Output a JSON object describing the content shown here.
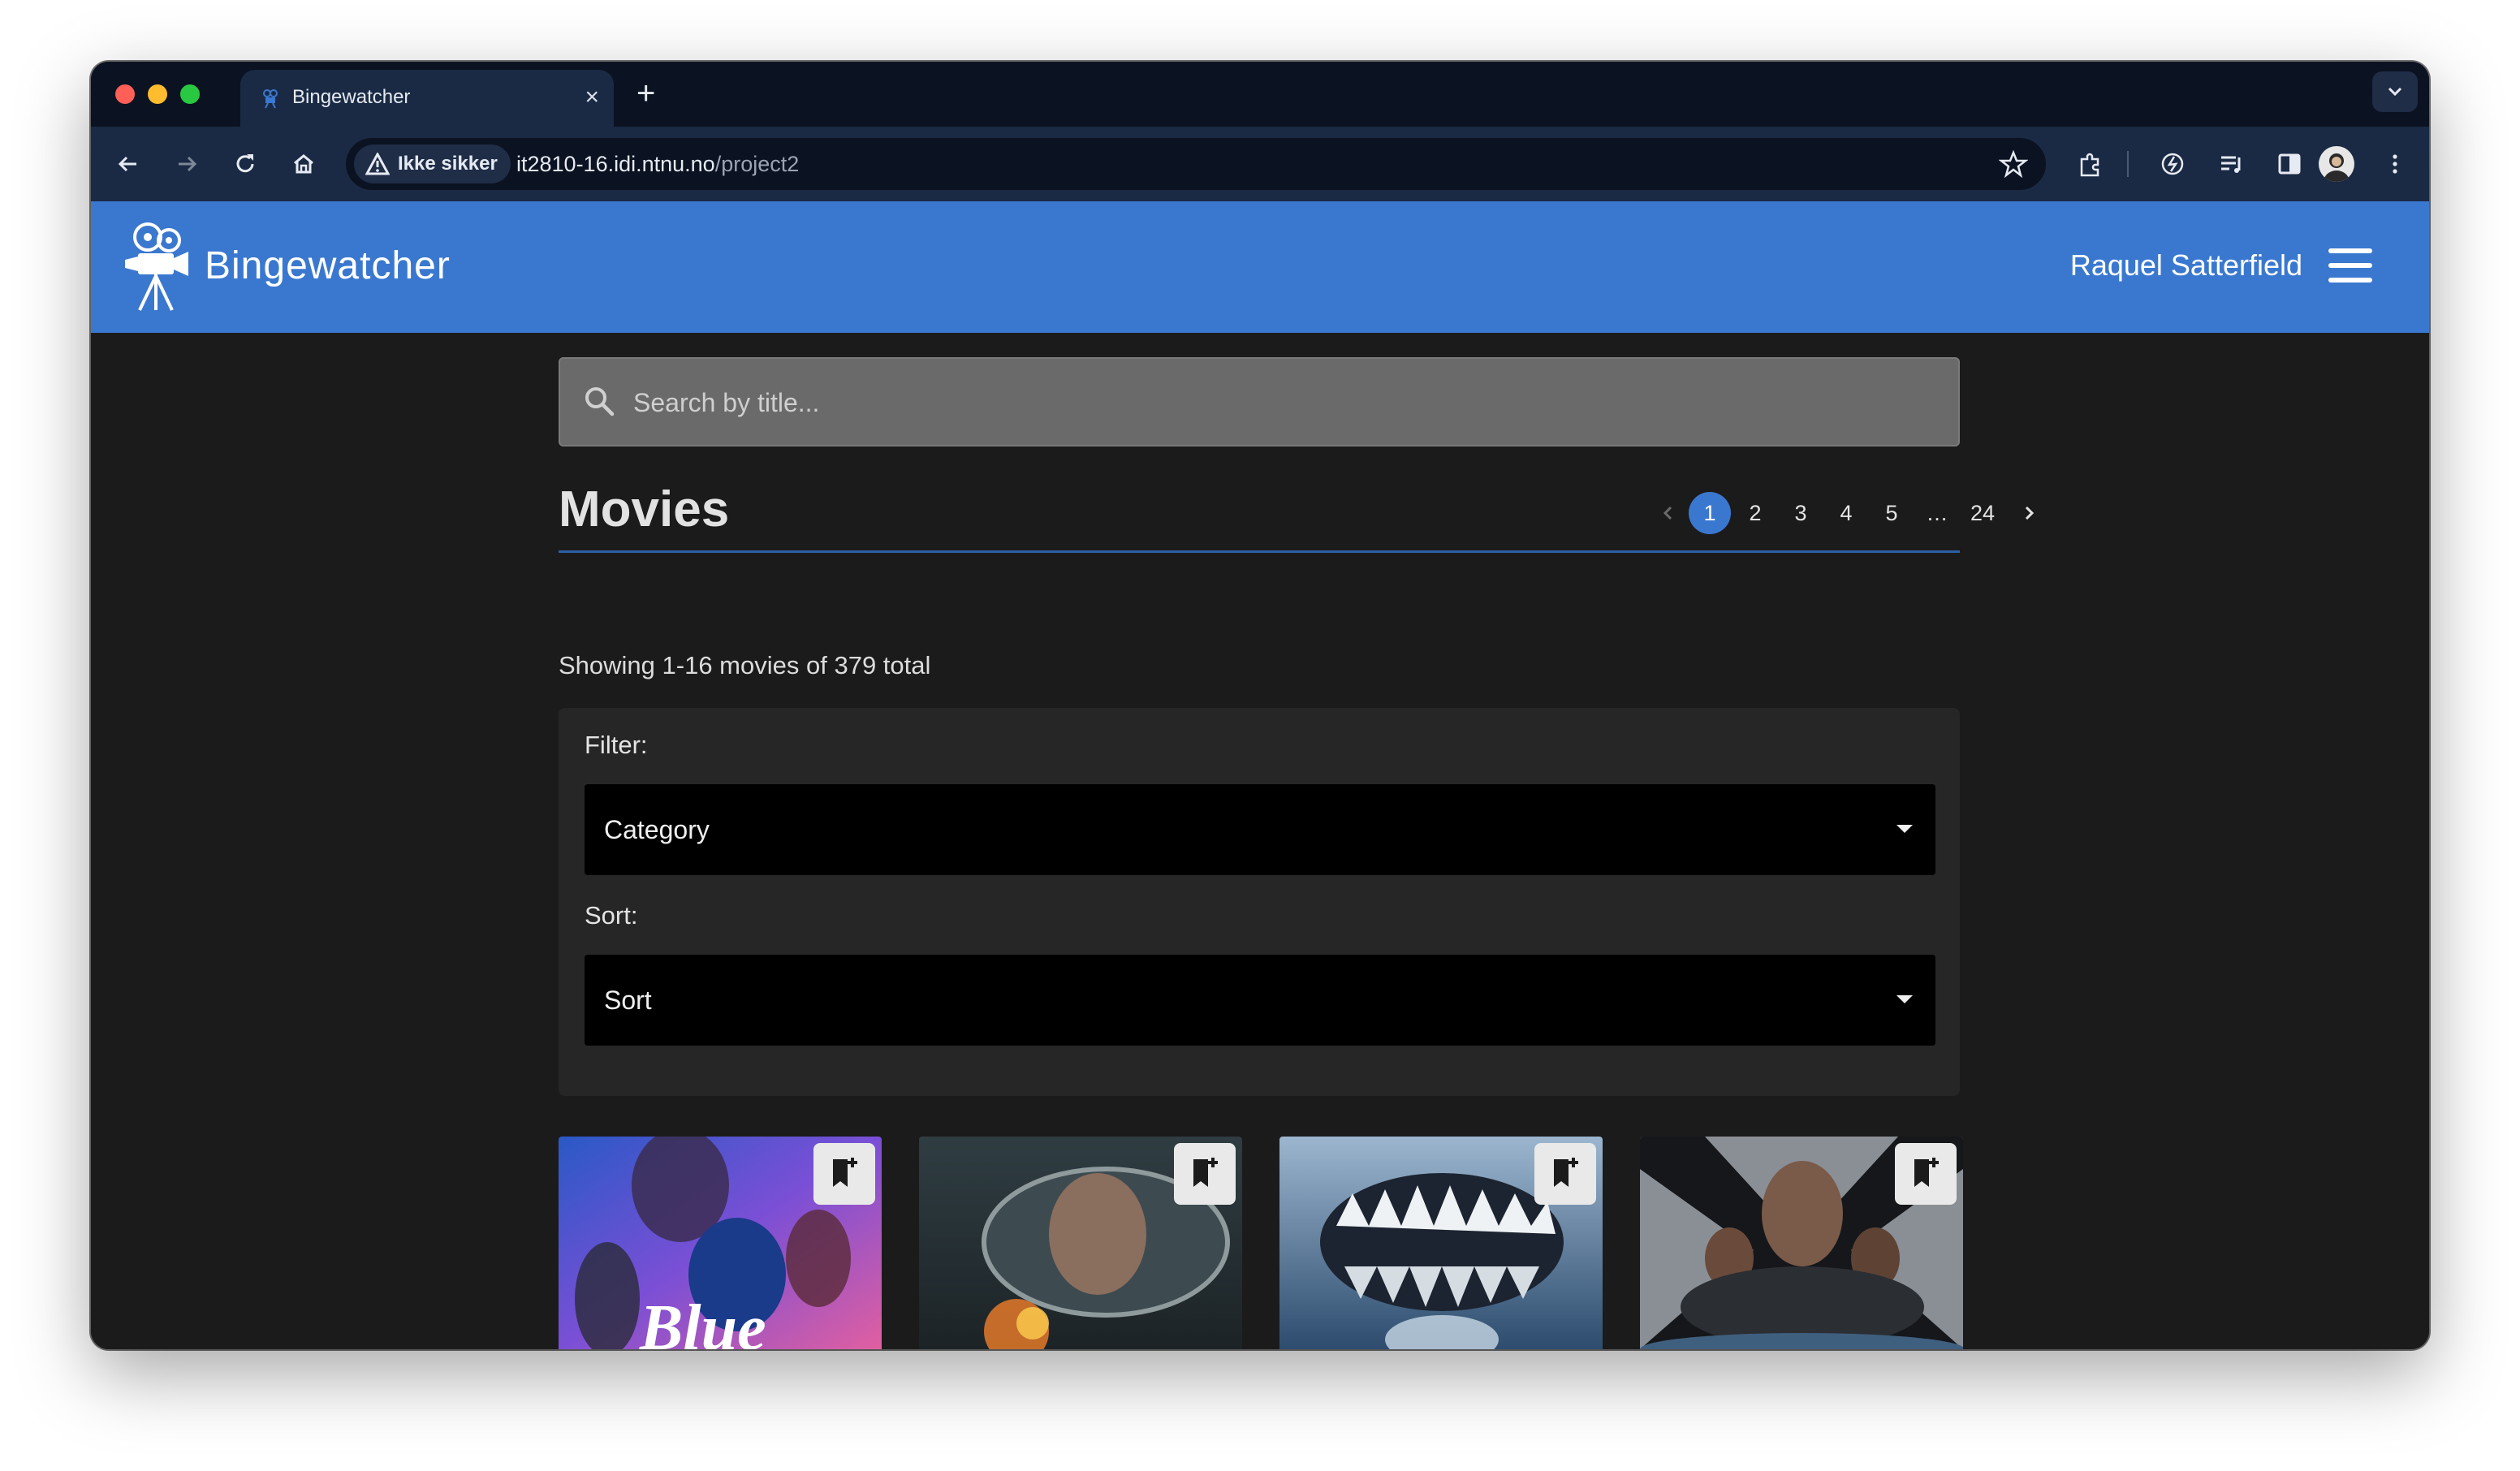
{
  "browser": {
    "tab_title": "Bingewatcher",
    "security_label": "Ikke sikker",
    "url_host": "it2810-16.idi.ntnu.no",
    "url_path": "/project2"
  },
  "app": {
    "brand": "Bingewatcher",
    "username": "Raquel Satterfield"
  },
  "search": {
    "placeholder": "Search by title..."
  },
  "page_title": "Movies",
  "pagination": {
    "current": 1,
    "pages": [
      "1",
      "2",
      "3",
      "4",
      "5",
      "…",
      "24"
    ]
  },
  "showing_text": "Showing 1-16 movies of 379 total",
  "filters": {
    "filter_label": "Filter:",
    "category_value": "Category",
    "sort_label": "Sort:",
    "sort_value": "Sort"
  },
  "colors": {
    "accent": "#3a78d0",
    "background": "#1b1b1b",
    "panel": "#262626"
  },
  "icons": [
    "search-icon",
    "bookmark-add-icon",
    "menu-icon",
    "chevron-left-icon",
    "chevron-right-icon",
    "camera-logo-icon"
  ]
}
